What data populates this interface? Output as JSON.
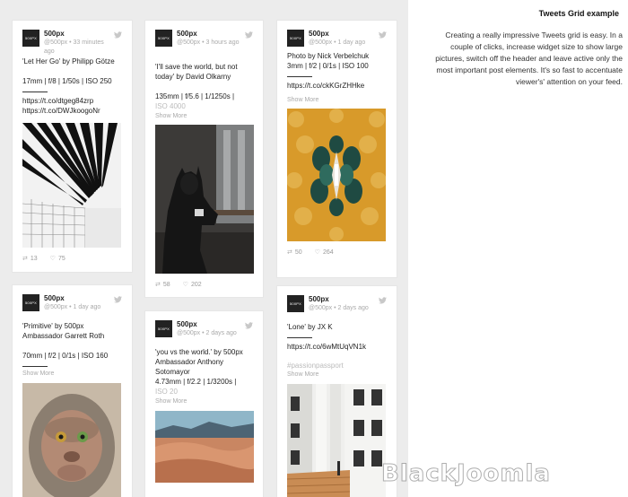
{
  "sidebar": {
    "title": "Tweets Grid example",
    "description": "Creating a really impressive Tweets grid is easy. In a couple of clicks, increase widget size to show large pictures, switch off the header and leave active only the most important post elements. It's so fast to accentuate viewer's' attention on your feed."
  },
  "watermark": "BlackJoomla",
  "cards": [
    {
      "logo": "500PX",
      "author": "500px",
      "meta": "@500px • 33 minutes ago",
      "text": "'Let Her Go' by Philipp Götze\n\n17mm | f/8 | 1/50s | ISO 250",
      "links": "https://t.co/dtgeg84zrp\nhttps://t.co/DWJkoogoNr",
      "retweets": "13",
      "likes": "75"
    },
    {
      "logo": "500PX",
      "author": "500px",
      "meta": "@500px • 3 hours ago",
      "text": "'I'll save the world, but not today' by David Olkarny\n\n135mm | f/5.6 | 1/1250s |",
      "faded": "ISO 4000",
      "more": "Show More",
      "retweets": "58",
      "likes": "202"
    },
    {
      "logo": "500PX",
      "author": "500px",
      "meta": "@500px • 1 day ago",
      "text": "Photo by Nick Verbelchuk\n3mm | f/2 | 0/1s | ISO 100",
      "links": "https://t.co/ckKGrZHHke",
      "more": "Show More",
      "retweets": "50",
      "likes": "264"
    },
    {
      "logo": "500PX",
      "author": "500px",
      "meta": "@500px • 1 day ago",
      "text": "'Primitive' by 500px Ambassador Garrett Roth\n\n70mm | f/2 | 0/1s | ISO 160",
      "more": "Show More"
    },
    {
      "logo": "500PX",
      "author": "500px",
      "meta": "@500px • 2 days ago",
      "text": "'you vs the world.' by 500px Ambassador Anthony Sotomayor\n4.73mm | f/2.2 | 1/3200s |",
      "faded": "ISO 20",
      "more": "Show More"
    },
    {
      "logo": "500PX",
      "author": "500px",
      "meta": "@500px • 2 days ago",
      "text": "'Lone' by JX K",
      "links": "https://t.co/6wMtUqVN1k",
      "faded": "#passionpassport",
      "more": "Show More"
    }
  ]
}
